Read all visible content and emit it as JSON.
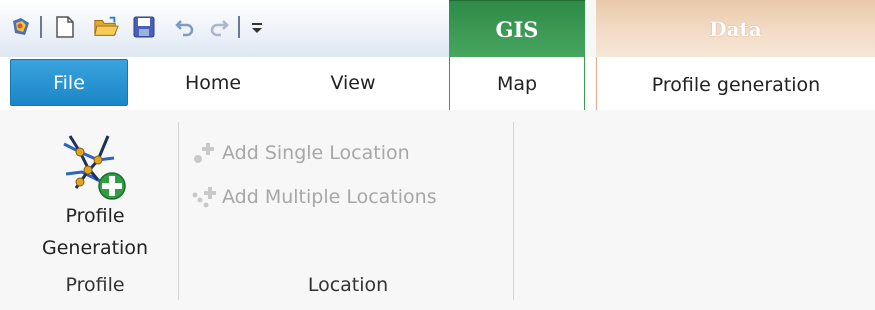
{
  "quick_access": {
    "items": [
      "app-icon",
      "new-document-icon",
      "open-folder-icon",
      "save-icon",
      "undo-icon",
      "redo-icon",
      "customize-dropdown-icon"
    ]
  },
  "contextual_groups": {
    "gis": "GIS",
    "data": "Data"
  },
  "tabs": {
    "file": "File",
    "home": "Home",
    "view": "View",
    "map": "Map",
    "profile_generation": "Profile generation"
  },
  "ribbon": {
    "profile_group": {
      "label": "Profile",
      "button_line1": "Profile",
      "button_line2": "Generation"
    },
    "location_group": {
      "label": "Location",
      "add_single": "Add Single Location",
      "add_multiple": "Add Multiple Locations"
    }
  },
  "colors": {
    "file_tab": "#1b86c7",
    "gis_group": "#3d9a55",
    "data_group": "#e9c9a8",
    "disabled_text": "#a7a7a7"
  }
}
